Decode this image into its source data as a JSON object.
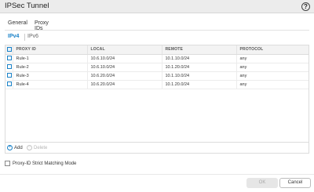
{
  "window": {
    "title": "IPSec Tunnel",
    "help_icon": "?"
  },
  "tabs": [
    {
      "label": "General"
    },
    {
      "label": "Proxy IDs",
      "active": true
    }
  ],
  "subtabs": [
    {
      "label": "IPv4",
      "active": true
    },
    {
      "label": "IPv6"
    }
  ],
  "table": {
    "columns": [
      "PROXY ID",
      "LOCAL",
      "REMOTE",
      "PROTOCOL"
    ],
    "rows": [
      {
        "proxy_id": "Rule-1",
        "local": "10.6.10.0/24",
        "remote": "10.1.10.0/24",
        "protocol": "any"
      },
      {
        "proxy_id": "Rule-2",
        "local": "10.6.10.0/24",
        "remote": "10.1.20.0/24",
        "protocol": "any"
      },
      {
        "proxy_id": "Rule-3",
        "local": "10.6.20.0/24",
        "remote": "10.1.10.0/24",
        "protocol": "any"
      },
      {
        "proxy_id": "Rule-4",
        "local": "10.6.20.0/24",
        "remote": "10.1.20.0/24",
        "protocol": "any"
      }
    ]
  },
  "actions": {
    "add_label": "Add",
    "delete_label": "Delete"
  },
  "options": {
    "strict_matching_label": "Proxy-ID Strict Matching Mode"
  },
  "buttons": {
    "ok_label": "OK",
    "cancel_label": "Cancel"
  },
  "colors": {
    "accent": "#1a82c8",
    "general_tab_underline": "#d86f00"
  }
}
